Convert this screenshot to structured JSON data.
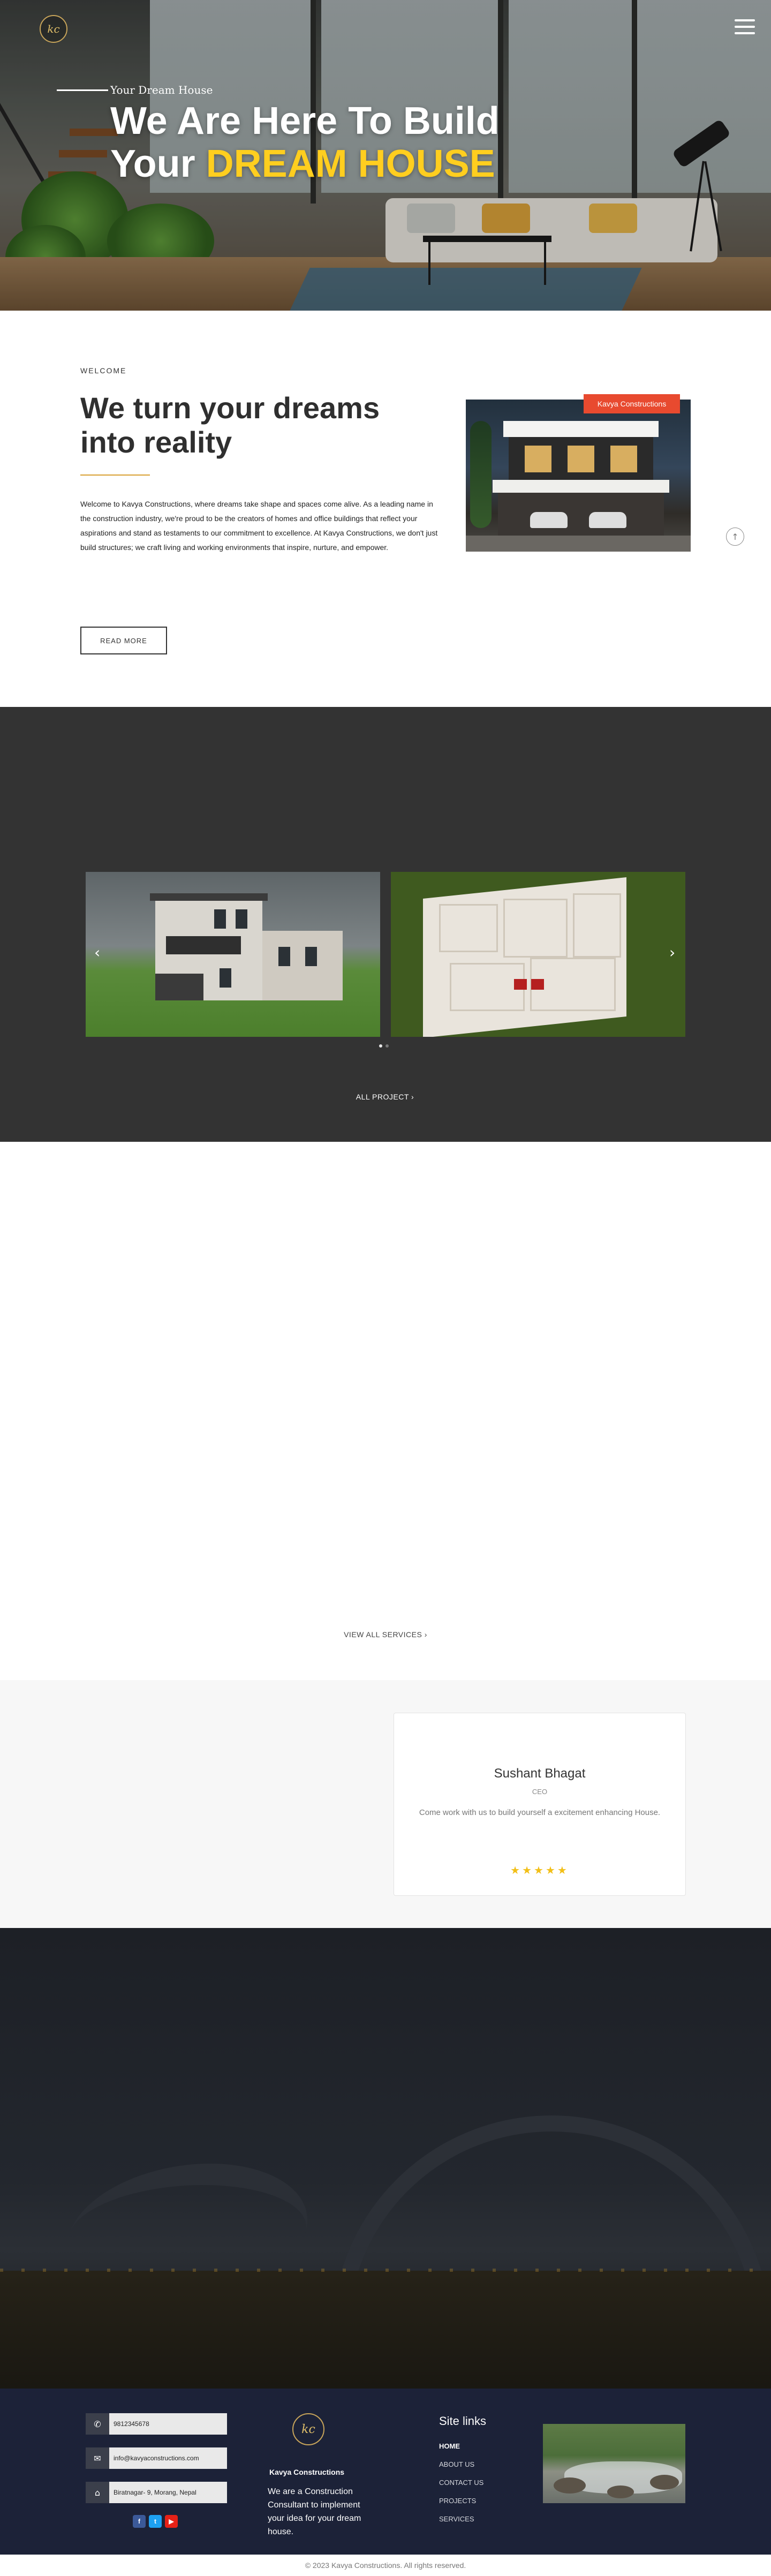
{
  "brand": {
    "logo_text": "kc",
    "name": "Kavya Constructions"
  },
  "hero": {
    "eyebrow": "Your Dream House",
    "title_line1": "We Are Here To Build",
    "title_line2_plain": "Your ",
    "title_line2_highlight": "DREAM HOUSE"
  },
  "about": {
    "eyebrow": "WELCOME",
    "title": "We turn your dreams into reality",
    "body": "Welcome to Kavya Constructions, where dreams take shape and spaces come alive. As a leading name in the construction industry, we're proud to be the creators of homes and office buildings that reflect your aspirations and stand as testaments to our commitment to excellence. At Kavya Constructions, we don't just build structures; we craft living and working environments that inspire, nurture, and empower.",
    "button": "READ MORE",
    "image_tag": "Kavya Constructions"
  },
  "projects": {
    "prev_icon": "‹",
    "next_icon": "›",
    "all_label": "ALL PROJECT",
    "all_icon": "›",
    "active_slide": 0,
    "slide_count": 2
  },
  "services": {
    "view_all": "VIEW ALL SERVICES",
    "view_all_icon": "›"
  },
  "testimonial": {
    "name": "Sushant Bhagat",
    "role": "CEO",
    "quote": "Come work with us to build yourself a excitement enhancing House.",
    "rating": 5,
    "stars": "★★★★★"
  },
  "footer": {
    "contacts": [
      {
        "icon": "phone-icon",
        "glyph": "✆",
        "value": "9812345678"
      },
      {
        "icon": "email-icon",
        "glyph": "✉",
        "value": "info@kavyaconstructions.com"
      },
      {
        "icon": "location-icon",
        "glyph": "⌂",
        "value": "Biratnagar- 9, Morang, Nepal"
      }
    ],
    "socials": [
      {
        "icon": "facebook-icon",
        "glyph": "f",
        "color": "#3b5998"
      },
      {
        "icon": "twitter-icon",
        "glyph": "t",
        "color": "#1da1f2"
      },
      {
        "icon": "youtube-icon",
        "glyph": "▶",
        "color": "#e62117"
      }
    ],
    "brand_name": "Kavya Constructions",
    "about": "We are a Construction Consultant to implement your idea for your dream house.",
    "links_title": "Site links",
    "links": [
      "HOME",
      "ABOUT US",
      "CONTACT US",
      "PROJECTS",
      "SERVICES"
    ],
    "active_link": "HOME",
    "copyright": "© 2023 Kavya Constructions. All rights reserved."
  },
  "colors": {
    "accent_yellow": "#ffce1f",
    "accent_red": "#e84a2f",
    "gold": "#c7a45a",
    "dark_section": "#333333",
    "footer_bg": "#1c2238"
  },
  "scroll_top_icon": "↑"
}
